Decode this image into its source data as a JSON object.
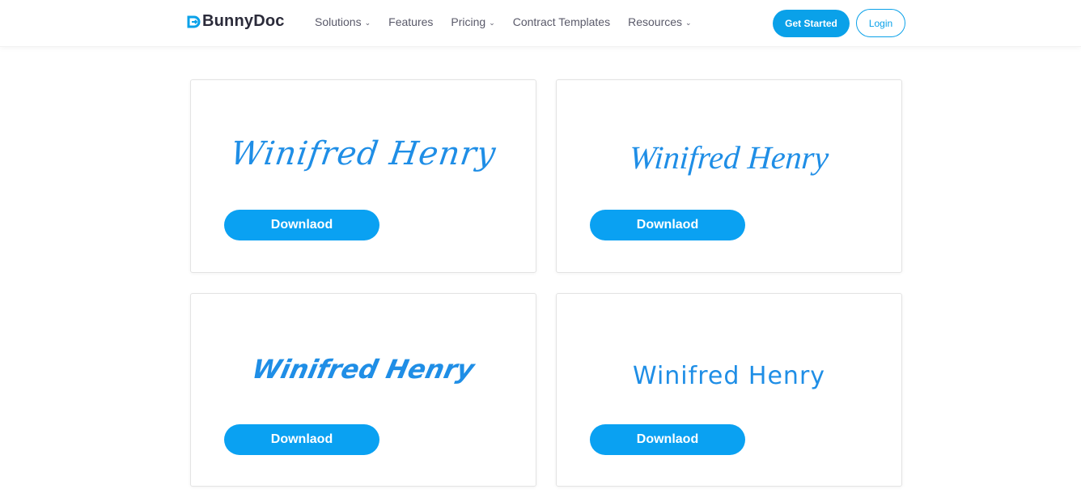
{
  "brand": {
    "name": "BunnyDoc",
    "logo_icon": "bunnydoc-logo-icon",
    "accent": "#0aa1e9"
  },
  "nav": {
    "items": [
      {
        "label": "Solutions",
        "has_dropdown": true
      },
      {
        "label": "Features",
        "has_dropdown": false
      },
      {
        "label": "Pricing",
        "has_dropdown": true
      },
      {
        "label": "Contract Templates",
        "has_dropdown": false
      },
      {
        "label": "Resources",
        "has_dropdown": true
      }
    ],
    "caret": "⌄"
  },
  "actions": {
    "get_started": "Get Started",
    "login": "Login"
  },
  "signatures": [
    {
      "text": "Winifred Henry",
      "download_label": "Downlaod"
    },
    {
      "text": "Winifred Henry",
      "download_label": "Downlaod"
    },
    {
      "text": "Winifred Henry",
      "download_label": "Downlaod"
    },
    {
      "text": "Winifred Henry",
      "download_label": "Downlaod"
    }
  ],
  "colors": {
    "signature": "#1f8ee6",
    "button": "#0aa1f2"
  }
}
